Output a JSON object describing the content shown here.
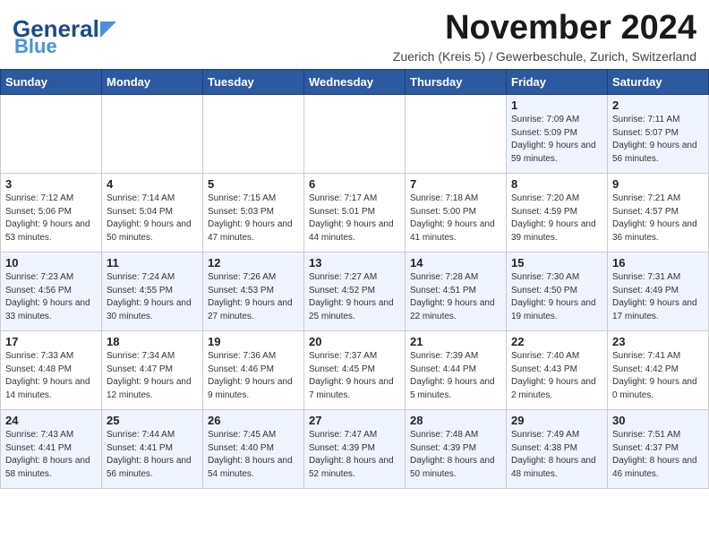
{
  "header": {
    "logo_general": "General",
    "logo_blue": "Blue",
    "main_title": "November 2024",
    "subtitle": "Zuerich (Kreis 5) / Gewerbeschule, Zurich, Switzerland"
  },
  "calendar": {
    "weekdays": [
      "Sunday",
      "Monday",
      "Tuesday",
      "Wednesday",
      "Thursday",
      "Friday",
      "Saturday"
    ],
    "weeks": [
      [
        {
          "day": "",
          "info": ""
        },
        {
          "day": "",
          "info": ""
        },
        {
          "day": "",
          "info": ""
        },
        {
          "day": "",
          "info": ""
        },
        {
          "day": "",
          "info": ""
        },
        {
          "day": "1",
          "info": "Sunrise: 7:09 AM\nSunset: 5:09 PM\nDaylight: 9 hours and 59 minutes."
        },
        {
          "day": "2",
          "info": "Sunrise: 7:11 AM\nSunset: 5:07 PM\nDaylight: 9 hours and 56 minutes."
        }
      ],
      [
        {
          "day": "3",
          "info": "Sunrise: 7:12 AM\nSunset: 5:06 PM\nDaylight: 9 hours and 53 minutes."
        },
        {
          "day": "4",
          "info": "Sunrise: 7:14 AM\nSunset: 5:04 PM\nDaylight: 9 hours and 50 minutes."
        },
        {
          "day": "5",
          "info": "Sunrise: 7:15 AM\nSunset: 5:03 PM\nDaylight: 9 hours and 47 minutes."
        },
        {
          "day": "6",
          "info": "Sunrise: 7:17 AM\nSunset: 5:01 PM\nDaylight: 9 hours and 44 minutes."
        },
        {
          "day": "7",
          "info": "Sunrise: 7:18 AM\nSunset: 5:00 PM\nDaylight: 9 hours and 41 minutes."
        },
        {
          "day": "8",
          "info": "Sunrise: 7:20 AM\nSunset: 4:59 PM\nDaylight: 9 hours and 39 minutes."
        },
        {
          "day": "9",
          "info": "Sunrise: 7:21 AM\nSunset: 4:57 PM\nDaylight: 9 hours and 36 minutes."
        }
      ],
      [
        {
          "day": "10",
          "info": "Sunrise: 7:23 AM\nSunset: 4:56 PM\nDaylight: 9 hours and 33 minutes."
        },
        {
          "day": "11",
          "info": "Sunrise: 7:24 AM\nSunset: 4:55 PM\nDaylight: 9 hours and 30 minutes."
        },
        {
          "day": "12",
          "info": "Sunrise: 7:26 AM\nSunset: 4:53 PM\nDaylight: 9 hours and 27 minutes."
        },
        {
          "day": "13",
          "info": "Sunrise: 7:27 AM\nSunset: 4:52 PM\nDaylight: 9 hours and 25 minutes."
        },
        {
          "day": "14",
          "info": "Sunrise: 7:28 AM\nSunset: 4:51 PM\nDaylight: 9 hours and 22 minutes."
        },
        {
          "day": "15",
          "info": "Sunrise: 7:30 AM\nSunset: 4:50 PM\nDaylight: 9 hours and 19 minutes."
        },
        {
          "day": "16",
          "info": "Sunrise: 7:31 AM\nSunset: 4:49 PM\nDaylight: 9 hours and 17 minutes."
        }
      ],
      [
        {
          "day": "17",
          "info": "Sunrise: 7:33 AM\nSunset: 4:48 PM\nDaylight: 9 hours and 14 minutes."
        },
        {
          "day": "18",
          "info": "Sunrise: 7:34 AM\nSunset: 4:47 PM\nDaylight: 9 hours and 12 minutes."
        },
        {
          "day": "19",
          "info": "Sunrise: 7:36 AM\nSunset: 4:46 PM\nDaylight: 9 hours and 9 minutes."
        },
        {
          "day": "20",
          "info": "Sunrise: 7:37 AM\nSunset: 4:45 PM\nDaylight: 9 hours and 7 minutes."
        },
        {
          "day": "21",
          "info": "Sunrise: 7:39 AM\nSunset: 4:44 PM\nDaylight: 9 hours and 5 minutes."
        },
        {
          "day": "22",
          "info": "Sunrise: 7:40 AM\nSunset: 4:43 PM\nDaylight: 9 hours and 2 minutes."
        },
        {
          "day": "23",
          "info": "Sunrise: 7:41 AM\nSunset: 4:42 PM\nDaylight: 9 hours and 0 minutes."
        }
      ],
      [
        {
          "day": "24",
          "info": "Sunrise: 7:43 AM\nSunset: 4:41 PM\nDaylight: 8 hours and 58 minutes."
        },
        {
          "day": "25",
          "info": "Sunrise: 7:44 AM\nSunset: 4:41 PM\nDaylight: 8 hours and 56 minutes."
        },
        {
          "day": "26",
          "info": "Sunrise: 7:45 AM\nSunset: 4:40 PM\nDaylight: 8 hours and 54 minutes."
        },
        {
          "day": "27",
          "info": "Sunrise: 7:47 AM\nSunset: 4:39 PM\nDaylight: 8 hours and 52 minutes."
        },
        {
          "day": "28",
          "info": "Sunrise: 7:48 AM\nSunset: 4:39 PM\nDaylight: 8 hours and 50 minutes."
        },
        {
          "day": "29",
          "info": "Sunrise: 7:49 AM\nSunset: 4:38 PM\nDaylight: 8 hours and 48 minutes."
        },
        {
          "day": "30",
          "info": "Sunrise: 7:51 AM\nSunset: 4:37 PM\nDaylight: 8 hours and 46 minutes."
        }
      ]
    ]
  }
}
